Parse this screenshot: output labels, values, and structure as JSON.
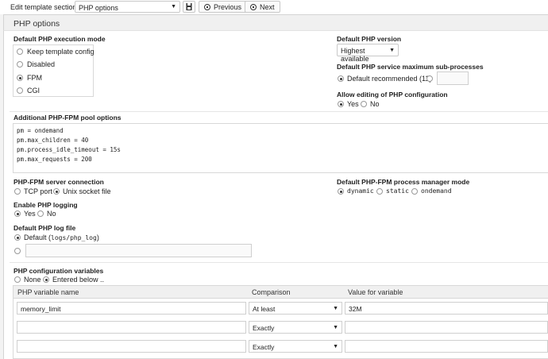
{
  "toolbar": {
    "label": "Edit template section:",
    "section_value": "PHP options",
    "previous": "Previous",
    "next": "Next"
  },
  "panel": {
    "title": "PHP options"
  },
  "exec_mode": {
    "label": "Default PHP execution mode",
    "options": [
      "Keep template config",
      "Disabled",
      "FPM",
      "CGI"
    ],
    "selected": "FPM"
  },
  "php_version": {
    "label": "Default PHP version",
    "value": "Highest available"
  },
  "max_sub": {
    "label": "Default PHP service maximum sub-processes",
    "option_default": "Default recommended (11)",
    "custom_value": ""
  },
  "allow_edit": {
    "label": "Allow editing of PHP configuration",
    "yes": "Yes",
    "no": "No",
    "selected": "Yes"
  },
  "fpm_pool": {
    "label": "Additional PHP-FPM pool options",
    "lines": [
      "pm = ondemand",
      "pm.max_children = 40",
      "pm.process_idle_timeout = 15s",
      "pm.max_requests = 200"
    ]
  },
  "fpm_conn": {
    "label": "PHP-FPM server connection",
    "tcp": "TCP port",
    "unix": "Unix socket file",
    "selected": "Unix socket file"
  },
  "fpm_mode": {
    "label": "Default PHP-FPM process manager mode",
    "options": [
      "dynamic",
      "static",
      "ondemand"
    ],
    "selected": "dynamic"
  },
  "logging": {
    "label": "Enable PHP logging",
    "yes": "Yes",
    "no": "No",
    "selected": "Yes"
  },
  "log_file": {
    "label": "Default PHP log file",
    "default_prefix": "Default (",
    "default_path": "logs/php_log",
    "default_suffix": ")",
    "custom_value": ""
  },
  "config_vars": {
    "label": "PHP configuration variables",
    "none": "None",
    "entered": "Entered below ..",
    "selected": "Entered below ..",
    "columns": [
      "PHP variable name",
      "Comparison",
      "Value for variable"
    ],
    "rows": [
      {
        "name": "memory_limit",
        "comparison": "At least",
        "value": "32M"
      },
      {
        "name": "",
        "comparison": "Exactly",
        "value": ""
      },
      {
        "name": "",
        "comparison": "Exactly",
        "value": ""
      }
    ]
  }
}
